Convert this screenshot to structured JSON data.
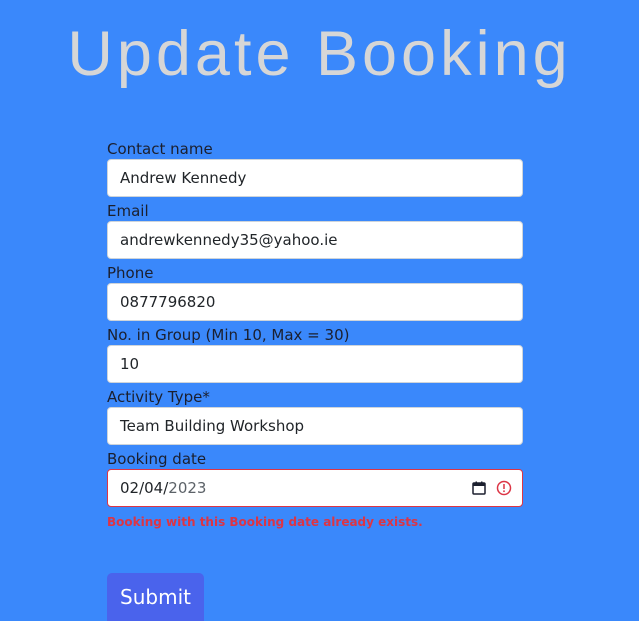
{
  "page": {
    "title": "Update Booking"
  },
  "form": {
    "contact_name": {
      "label": "Contact name",
      "value": "Andrew Kennedy"
    },
    "email": {
      "label": "Email",
      "value": "andrewkennedy35@yahoo.ie"
    },
    "phone": {
      "label": "Phone",
      "value": "0877796820"
    },
    "group_size": {
      "label": "No. in Group (Min 10, Max = 30)",
      "value": "10"
    },
    "activity_type": {
      "label": "Activity Type*",
      "value": "Team Building Workshop"
    },
    "booking_date": {
      "label": "Booking date",
      "value_day_month": "02/04/",
      "value_year": "2023",
      "error": "Booking with this Booking date already exists.",
      "calendar_icon": "calendar-icon",
      "error_icon": "error-circle-icon"
    },
    "submit_label": "Submit"
  },
  "colors": {
    "background": "#3a88fb",
    "title": "#d6d6d6",
    "error": "#dc3545",
    "submit_button": "#4a63ec"
  }
}
